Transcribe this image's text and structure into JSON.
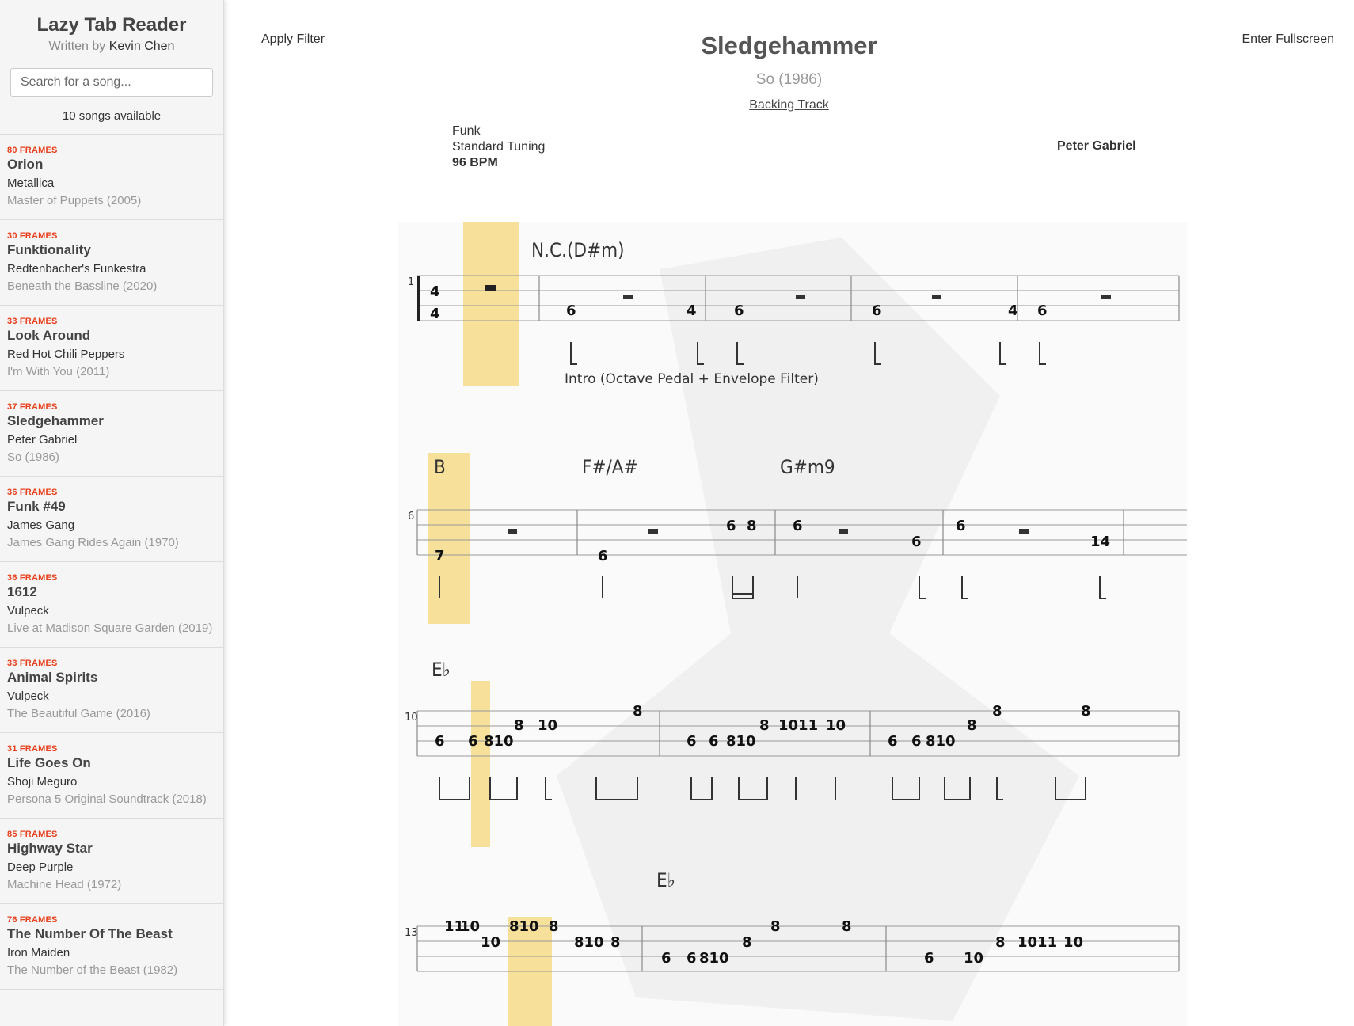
{
  "sidebar": {
    "app_title": "Lazy Tab Reader",
    "byline_prefix": "Written by",
    "author": "Kevin Chen",
    "search_placeholder": "Search for a song...",
    "count_text": "10 songs available",
    "songs": [
      {
        "frames": "80 FRAMES",
        "title": "Orion",
        "artist": "Metallica",
        "album": "Master of Puppets (2005)"
      },
      {
        "frames": "30 FRAMES",
        "title": "Funktionality",
        "artist": "Redtenbacher's Funkestra",
        "album": "Beneath the Bassline (2020)"
      },
      {
        "frames": "33 FRAMES",
        "title": "Look Around",
        "artist": "Red Hot Chili Peppers",
        "album": "I'm With You (2011)"
      },
      {
        "frames": "37 FRAMES",
        "title": "Sledgehammer",
        "artist": "Peter Gabriel",
        "album": "So (1986)"
      },
      {
        "frames": "36 FRAMES",
        "title": "Funk #49",
        "artist": "James Gang",
        "album": "James Gang Rides Again (1970)"
      },
      {
        "frames": "36 FRAMES",
        "title": "1612",
        "artist": "Vulpeck",
        "album": "Live at Madison Square Garden (2019)"
      },
      {
        "frames": "33 FRAMES",
        "title": "Animal Spirits",
        "artist": "Vulpeck",
        "album": "The Beautiful Game (2016)"
      },
      {
        "frames": "31 FRAMES",
        "title": "Life Goes On",
        "artist": "Shoji Meguro",
        "album": "Persona 5 Original Soundtrack (2018)"
      },
      {
        "frames": "85 FRAMES",
        "title": "Highway Star",
        "artist": "Deep Purple",
        "album": "Machine Head (1972)"
      },
      {
        "frames": "76 FRAMES",
        "title": "The Number Of The Beast",
        "artist": "Iron Maiden",
        "album": "The Number of the Beast (1982)"
      }
    ]
  },
  "main": {
    "apply_filter": "Apply Filter",
    "fullscreen": "Enter Fullscreen",
    "title": "Sledgehammer",
    "subtitle": "So (1986)",
    "backing_track": "Backing Track",
    "genre": "Funk",
    "tuning": "Standard Tuning",
    "bpm": "96 BPM",
    "artist": "Peter Gabriel"
  },
  "sheet": {
    "system1_chord": "N.C.(D#m)",
    "system1_label": "Intro (Octave Pedal + Envelope Filter)",
    "system2_chords": [
      "B",
      "F#/A#",
      "G#m9"
    ],
    "system3_chord": "E♭",
    "system4_chord": "E♭",
    "measure_numbers": [
      "1",
      "6",
      "10",
      "13"
    ],
    "time_sig": [
      "4",
      "4"
    ],
    "highlight_color": "#f7e19a"
  }
}
